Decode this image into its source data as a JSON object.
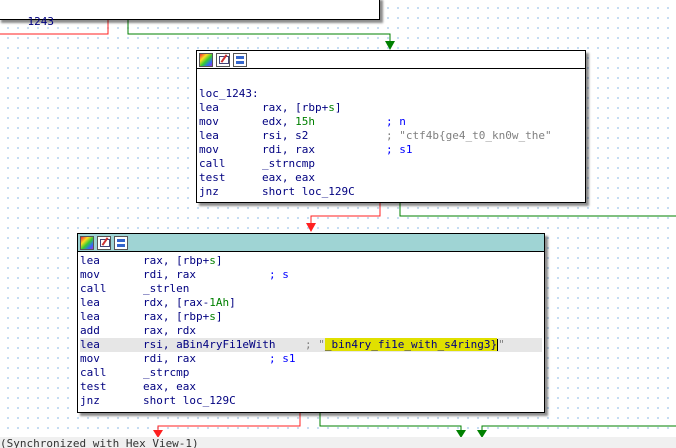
{
  "top_block": {
    "label": "1243"
  },
  "block_loc1243": {
    "label": "loc_1243:",
    "lines": [
      {
        "mn": "lea",
        "op1": "rax, [rbp+",
        "op_s": "s",
        "op2": "]",
        "c1": "",
        "c2": ""
      },
      {
        "mn": "mov",
        "op1": "edx, ",
        "num": "15h",
        "c1": "; n"
      },
      {
        "mn": "lea",
        "op1": "rsi, s2",
        "c1": "; \"ctf4b{ge4_t0_kn0w_the\""
      },
      {
        "mn": "mov",
        "op1": "rdi, rax",
        "c1": "; s1"
      },
      {
        "mn": "call",
        "op1": "_strncmp"
      },
      {
        "mn": "test",
        "op1": "eax, eax"
      },
      {
        "mn": "jnz",
        "op1": "short loc_129C"
      }
    ]
  },
  "block_2": {
    "lines": [
      {
        "mn": "lea",
        "op1": "rax, [rbp+",
        "op_s": "s",
        "op2": "]"
      },
      {
        "mn": "mov",
        "op1": "rdi, rax",
        "c1": "; s"
      },
      {
        "mn": "call",
        "op1": "_strlen"
      },
      {
        "mn": "lea",
        "op1": "rdx, [rax-",
        "num": "1Ah",
        "op2": "]"
      },
      {
        "mn": "lea",
        "op1": "rax, [rbp+",
        "op_s": "s",
        "op2": "]"
      },
      {
        "mn": "add",
        "op1": "rax, rdx"
      },
      {
        "mn": "lea",
        "op1": "rsi, aBin4ryFi1eWith",
        "c_prefix": "; \"",
        "c_hl": "_bin4ry_fi1e_with_s4ring3}",
        "c_suffix": "\""
      },
      {
        "mn": "mov",
        "op1": "rdi, rax",
        "c1": "; s1"
      },
      {
        "mn": "call",
        "op1": "_strcmp"
      },
      {
        "mn": "test",
        "op1": "eax, eax"
      },
      {
        "mn": "jnz",
        "op1": "short loc_129C"
      }
    ]
  },
  "status_text": "(Synchronized with Hex View-1)",
  "colors": {
    "edge_true": "#008000",
    "edge_false": "#ff0000",
    "header_teal": "#9fd4d4"
  }
}
